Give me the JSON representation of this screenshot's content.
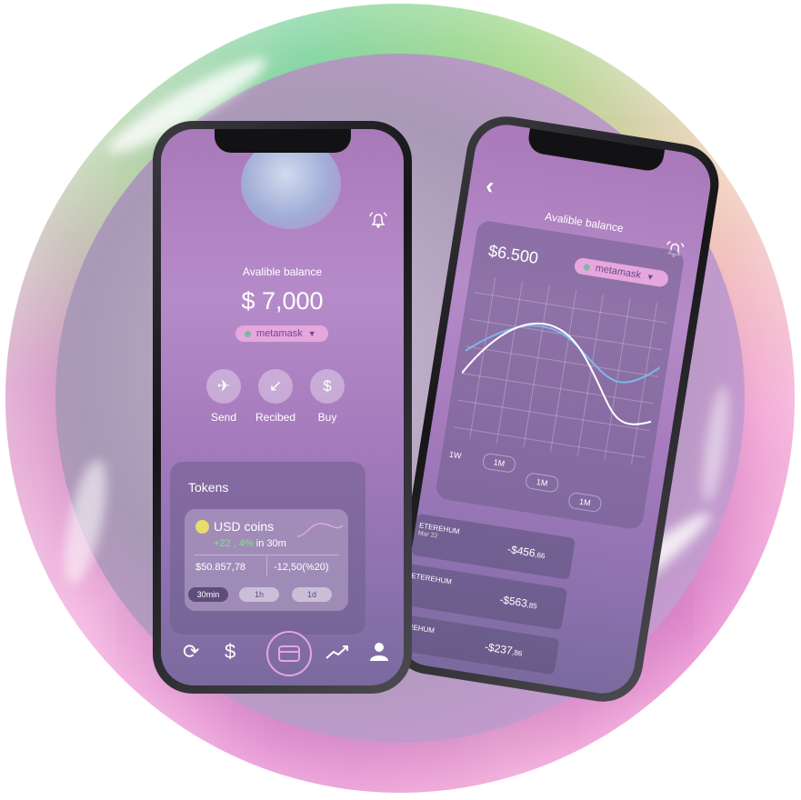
{
  "left_phone": {
    "balance_label": "Avalible balance",
    "balance_value": "$ 7,000",
    "wallet_selector": "metamask",
    "actions": [
      {
        "label": "Send",
        "icon": "paper-plane-icon"
      },
      {
        "label": "Recibed",
        "icon": "arrow-down-left-icon"
      },
      {
        "label": "Buy",
        "icon": "dollar-icon"
      }
    ],
    "tokens": {
      "title": "Tokens",
      "coin_name": "USD coins",
      "change": "+22 , 4%",
      "change_suffix": "in 30m",
      "value": "$50.857,78",
      "delta": "-12,50(%20)",
      "timeframes": [
        "30min",
        "1h",
        "1d"
      ]
    },
    "nav_icons": [
      "refresh-icon",
      "exchange-icon",
      "card-icon",
      "trend-icon",
      "profile-icon"
    ]
  },
  "right_phone": {
    "balance_label": "Avalible balance",
    "balance_value": "$6.500",
    "wallet_selector": "metamask",
    "timeframes": [
      "1W",
      "1M",
      "1M",
      "1M"
    ],
    "transactions": [
      {
        "name": "ETEREHUM",
        "date": "Mar 22",
        "amount": "-$456",
        "cents": ",66"
      },
      {
        "name": "ETEREHUM",
        "date": "",
        "amount": "-$563",
        "cents": ",85"
      },
      {
        "name": "EREHUM",
        "date": "",
        "amount": "-$237",
        "cents": ",86"
      }
    ]
  },
  "colors": {
    "accent_pink": "#e6a6de",
    "coin_yellow": "#e8dc6a",
    "positive": "#7ee08e"
  }
}
